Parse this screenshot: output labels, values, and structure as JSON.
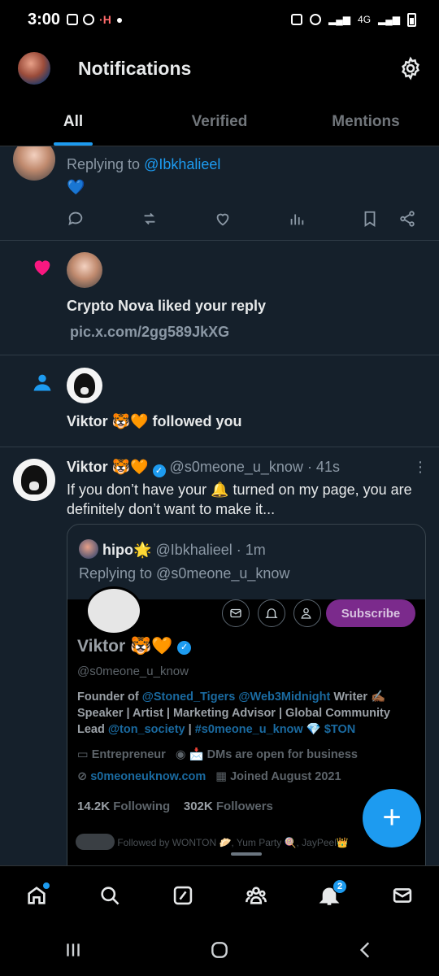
{
  "status_bar": {
    "time": "3:00",
    "network": "4G",
    "left_icons": [
      "gallery-icon",
      "whatsapp-icon",
      "app-icon"
    ],
    "left_icon_text": "·H"
  },
  "header": {
    "title": "Notifications"
  },
  "tabs": [
    {
      "label": "All",
      "active": true
    },
    {
      "label": "Verified",
      "active": false
    },
    {
      "label": "Mentions",
      "active": false
    }
  ],
  "items": {
    "reply": {
      "replying_prefix": "Replying to ",
      "replying_handle": "@Ibkhalieel",
      "body": "💙"
    },
    "like": {
      "text": "Crypto Nova liked your reply",
      "link": "pic.x.com/2gg589JkXG"
    },
    "follow": {
      "text": "Viktor 🐯🧡 followed you"
    },
    "post": {
      "name": "Viktor 🐯🧡",
      "handle": "@s0meone_u_know",
      "time": "· 41s",
      "body": "If you don’t have your 🔔 turned on my page, you are definitely don’t want to make it...",
      "quote": {
        "name": "hipo🌟",
        "handle": "@Ibkhalieel",
        "time": "· 1m",
        "replying": "Replying to @s0meone_u_know",
        "profile": {
          "subscribe": "Subscribe",
          "name": "Viktor 🐯🧡",
          "handle": "@s0meone_u_know",
          "bio_1": "Founder of ",
          "bio_link1": "@Stoned_Tigers",
          "bio_link2": "@Web3Midnight",
          "bio_2": " Writer ✍🏾",
          "bio_3": "Speaker | Artist | Marketing Advisor | Global Community",
          "bio_4": "Lead ",
          "bio_link3": "@ton_society",
          "bio_5": " | ",
          "bio_link4": "#s0meone_u_know",
          "bio_link5": "💎 $TON",
          "category": "Entrepreneur",
          "location": "📩 DMs are open for business",
          "website": "s0meoneuknow.com",
          "joined": "Joined August 2021",
          "following_count": "14.2K",
          "following_label": "Following",
          "followers_count": "302K",
          "followers_label": "Followers",
          "followed_by": "Followed by WONTON 🥟, Yum Party 🍭, JayPeel👑"
        }
      }
    }
  },
  "bottom_nav": {
    "items": [
      "home-icon",
      "search-icon",
      "grok-icon",
      "communities-icon",
      "notifications-icon",
      "messages-icon"
    ],
    "notifications_badge": "2"
  },
  "colors": {
    "accent": "#1d9bf0",
    "feed_bg": "#15202b",
    "heart": "#f91880",
    "subscribe": "#7b2a8c"
  }
}
